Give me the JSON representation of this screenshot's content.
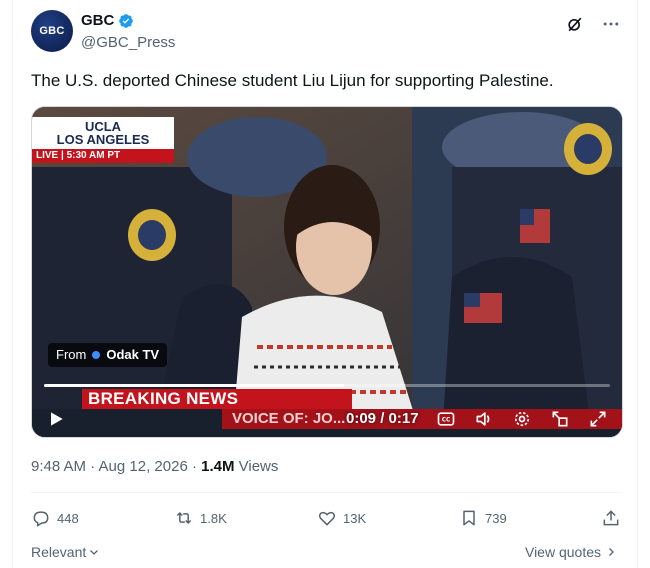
{
  "post": {
    "author_name": "GBC",
    "author_handle": "@GBC_Press",
    "avatar_text": "GBC",
    "text": "The U.S. deported Chinese student Liu Lijun for supporting Palestine."
  },
  "media": {
    "location_line1": "UCLA",
    "location_line2": "LOS ANGELES",
    "live_tag": "LIVE | 5:30 AM PT",
    "from_prefix": "From",
    "from_source": "Odak TV",
    "breaking": "BREAKING NEWS",
    "chyron": "VOICE OF: JO...",
    "time_display": "0:09 / 0:17",
    "progress": 0.53
  },
  "meta": {
    "timestamp": "9:48 AM · Aug 12, 2026 · ",
    "views_count": "1.4M",
    "views_label": " Views"
  },
  "actions": {
    "replies": "448",
    "reposts": "1.8K",
    "likes": "13K",
    "bookmarks": "739"
  },
  "footer": {
    "sort_label": "Relevant",
    "view_quotes": "View quotes"
  },
  "colors": {
    "verified": "#1d9bf0",
    "breaking_red": "#c3131c",
    "muted_text": "#536471"
  }
}
